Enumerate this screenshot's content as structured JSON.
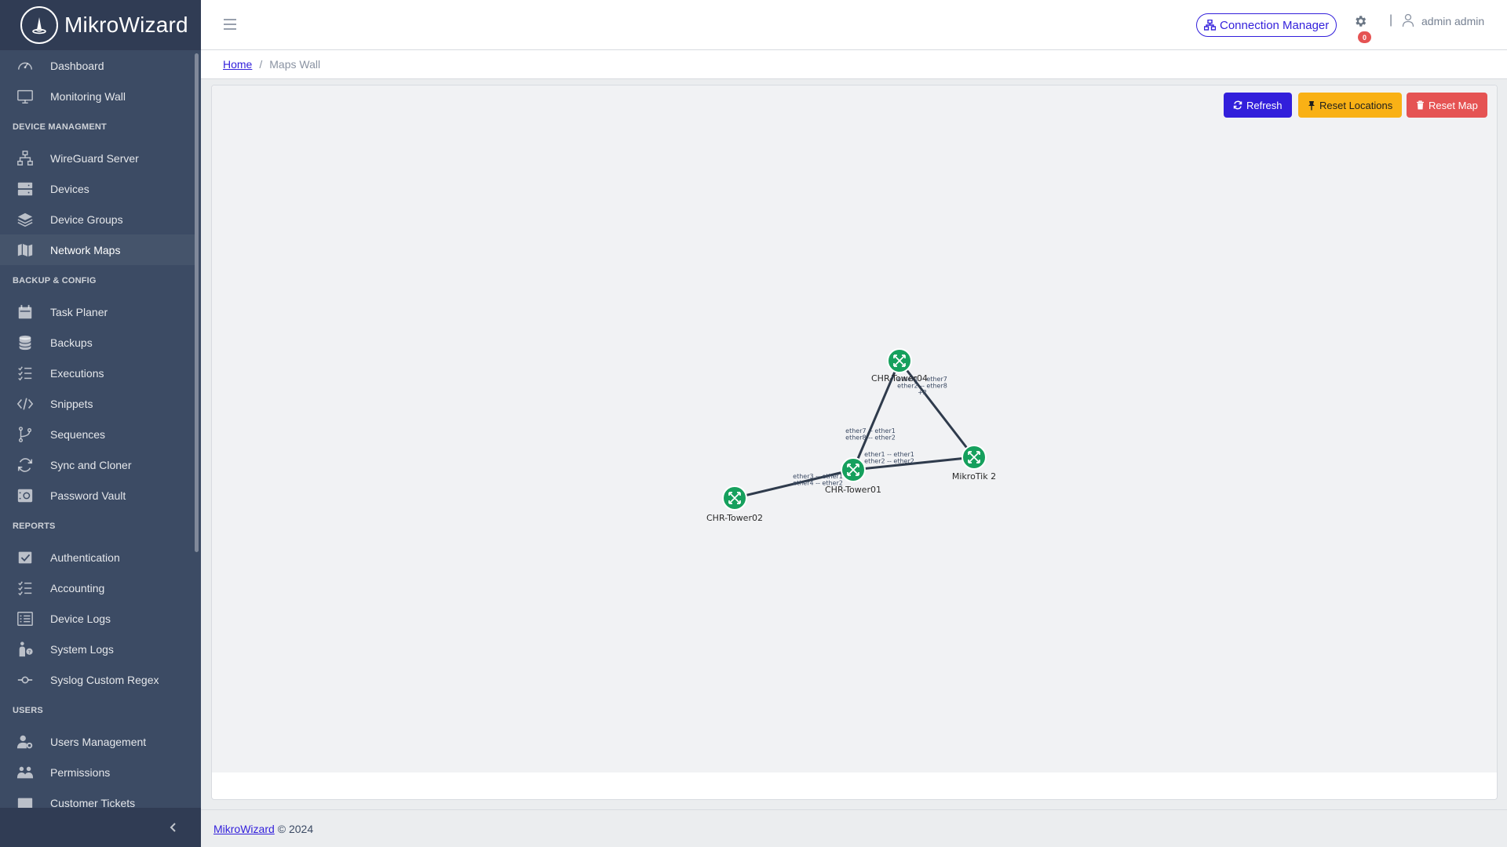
{
  "brand": {
    "name": "MikroWizard"
  },
  "sidebar": {
    "items": [
      {
        "type": "item",
        "label": "Dashboard",
        "icon": "speedometer-icon"
      },
      {
        "type": "item",
        "label": "Monitoring Wall",
        "icon": "monitor-icon"
      },
      {
        "type": "title",
        "label": "DEVICE MANAGMENT"
      },
      {
        "type": "item",
        "label": "WireGuard Server",
        "icon": "network-icon"
      },
      {
        "type": "item",
        "label": "Devices",
        "icon": "server-icon"
      },
      {
        "type": "item",
        "label": "Device Groups",
        "icon": "layers-icon"
      },
      {
        "type": "item",
        "label": "Network Maps",
        "icon": "map-icon",
        "active": true
      },
      {
        "type": "title",
        "label": "BACKUP & CONFIG"
      },
      {
        "type": "item",
        "label": "Task Planer",
        "icon": "calendar-icon"
      },
      {
        "type": "item",
        "label": "Backups",
        "icon": "database-icon"
      },
      {
        "type": "item",
        "label": "Executions",
        "icon": "list-check-icon"
      },
      {
        "type": "item",
        "label": "Snippets",
        "icon": "code-icon"
      },
      {
        "type": "item",
        "label": "Sequences",
        "icon": "branch-icon"
      },
      {
        "type": "item",
        "label": "Sync and Cloner",
        "icon": "sync-icon"
      },
      {
        "type": "item",
        "label": "Password Vault",
        "icon": "vault-icon"
      },
      {
        "type": "title",
        "label": "REPORTS"
      },
      {
        "type": "item",
        "label": "Authentication",
        "icon": "check-box-icon"
      },
      {
        "type": "item",
        "label": "Accounting",
        "icon": "list-check-icon"
      },
      {
        "type": "item",
        "label": "Device Logs",
        "icon": "list-rich-icon"
      },
      {
        "type": "item",
        "label": "System Logs",
        "icon": "person-question-icon"
      },
      {
        "type": "item",
        "label": "Syslog Custom Regex",
        "icon": "commit-icon"
      },
      {
        "type": "title",
        "label": "USERS"
      },
      {
        "type": "item",
        "label": "Users Management",
        "icon": "user-gear-icon"
      },
      {
        "type": "item",
        "label": "Permissions",
        "icon": "people-icon"
      },
      {
        "type": "item",
        "label": "Customer Tickets",
        "icon": "ticket-icon"
      }
    ]
  },
  "header": {
    "connection_manager_label": "Connection Manager",
    "notification_count": "0",
    "separator": "|",
    "user_name": "admin admin"
  },
  "breadcrumb": {
    "home": "Home",
    "separator": "/",
    "current": "Maps Wall"
  },
  "map": {
    "buttons": {
      "refresh": "Refresh",
      "reset_locations": "Reset Locations",
      "reset_map": "Reset Map"
    },
    "node_color": "#16a05d",
    "link_color": "#2f3b4c",
    "nodes": [
      {
        "id": "t04",
        "label": "CHR-Tower04"
      },
      {
        "id": "t01",
        "label": "CHR-Tower01"
      },
      {
        "id": "t02",
        "label": "CHR-Tower02"
      },
      {
        "id": "mk2",
        "label": "MikroTik 2"
      }
    ],
    "links": [
      {
        "from": "t04",
        "to": "t01",
        "labels": [
          "ether7 -- ether1",
          "ether8 -- ether2"
        ]
      },
      {
        "from": "t04",
        "to": "mk2",
        "labels": [
          "ether1 -- ether7",
          "ether2 -- ether8",
          "+2"
        ]
      },
      {
        "from": "t01",
        "to": "mk2",
        "labels": [
          "ether1 -- ether1",
          "ether2 -- ether2"
        ]
      },
      {
        "from": "t02",
        "to": "t01",
        "labels": [
          "ether3 -- ether1",
          "ether4 -- ether2"
        ]
      }
    ]
  },
  "footer": {
    "link": "MikroWizard",
    "text": "© 2024"
  }
}
